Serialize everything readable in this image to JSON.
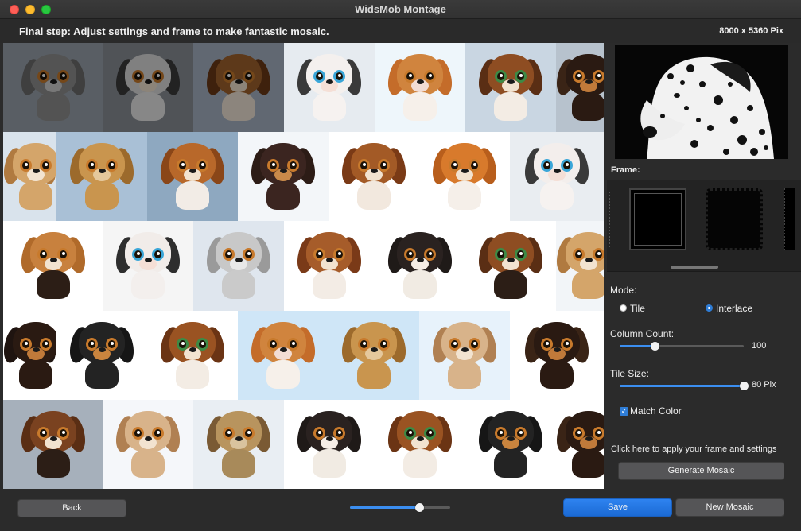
{
  "window": {
    "title": "WidsMob Montage"
  },
  "header": {
    "step_text": "Final step: Adjust settings and frame to make fantastic mosaic.",
    "dimensions": "8000 x 5360 Pix"
  },
  "sidebar": {
    "frame_label": "Frame:",
    "mode_label": "Mode:",
    "mode_options": [
      {
        "label": "Tile",
        "selected": false
      },
      {
        "label": "Interlace",
        "selected": true
      }
    ],
    "column_count": {
      "label": "Column Count:",
      "value": "100",
      "fraction": 0.28
    },
    "tile_size": {
      "label": "Tile Size:",
      "value": "80 Pix",
      "fraction": 1.0
    },
    "match_color": {
      "label": "Match Color",
      "checked": true
    },
    "apply_hint": "Click here to apply your frame and settings",
    "generate_label": "Generate Mosaic"
  },
  "bottom": {
    "back_label": "Back",
    "save_label": "Save",
    "new_mosaic_label": "New Mosaic",
    "zoom_fraction": 0.69
  },
  "colors": {
    "accent": "#2f7dd6",
    "window_bg": "#2b2b2b"
  }
}
